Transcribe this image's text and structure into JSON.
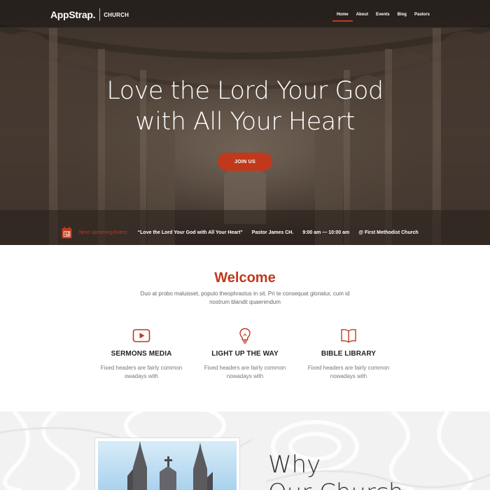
{
  "header": {
    "brand": "AppStrap.",
    "brand_sub": "CHURCH",
    "nav": [
      {
        "label": "Home",
        "active": true
      },
      {
        "label": "About",
        "active": false
      },
      {
        "label": "Events",
        "active": false
      },
      {
        "label": "Blog",
        "active": false
      },
      {
        "label": "Pastors",
        "active": false
      }
    ]
  },
  "hero": {
    "title_line1": "Love the Lord Your God",
    "title_line2": "with All Your Heart",
    "cta_label": "JOIN US"
  },
  "event": {
    "label": "Next Upcoming Event:",
    "title": "“Love the Lord Your God with All Your Heart”",
    "pastor": "Pastor James CH.",
    "time": "9:00 am — 10:00 am",
    "location": "@ First Methodist Church"
  },
  "welcome": {
    "title": "Welcome",
    "subtitle": "Duo at probo maluisset, populo theophrastus in sit. Pri te consequat gloriatur, cum id nostrum blandit quaerendum"
  },
  "features": [
    {
      "icon": "play-icon",
      "title": "SERMONS MEDIA",
      "desc_line1": "Fixed headers are fairly common",
      "desc_line2": "owadays with"
    },
    {
      "icon": "lightbulb-icon",
      "title": "LIGHT UP THE WAY",
      "desc_line1": "Fixed headers are fairly common",
      "desc_line2": "nowadays with"
    },
    {
      "icon": "book-icon",
      "title": "BIBLE LIBRARY",
      "desc_line1": "Fixed headers are fairly common",
      "desc_line2": "nowadays with"
    }
  ],
  "why": {
    "title_line1": "Why",
    "title_line2": "Our Church"
  },
  "colors": {
    "accent": "#c0391c"
  }
}
